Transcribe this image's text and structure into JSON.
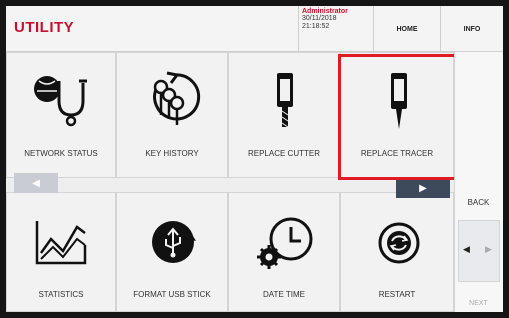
{
  "header": {
    "title": "UTILITY",
    "user": "Administrator",
    "date": "30/11/2018",
    "time": "21:18:52",
    "home_label": "HOME",
    "info_label": "INFO"
  },
  "tiles": [
    {
      "label": "NETWORK STATUS",
      "icon": "stethoscope-globe-icon"
    },
    {
      "label": "KEY HISTORY",
      "icon": "key-history-icon"
    },
    {
      "label": "REPLACE CUTTER",
      "icon": "cutter-icon"
    },
    {
      "label": "REPLACE TRACER",
      "icon": "tracer-icon"
    },
    {
      "label": "STATISTICS",
      "icon": "statistics-chart-icon"
    },
    {
      "label": "FORMAT USB STICK",
      "icon": "usb-format-icon"
    },
    {
      "label": "DATE TIME",
      "icon": "clock-gear-icon"
    },
    {
      "label": "RESTART",
      "icon": "restart-icon"
    }
  ],
  "nav": {
    "back_label": "BACK",
    "next_label": "NEXT",
    "prev_arrow": "◀",
    "next_arrow": "▶",
    "left_arrow": "◀",
    "right_arrow": "▶"
  },
  "colors": {
    "brand_red": "#c8102e",
    "highlight": "#e01b24",
    "dark_button": "#3c4a5c"
  }
}
